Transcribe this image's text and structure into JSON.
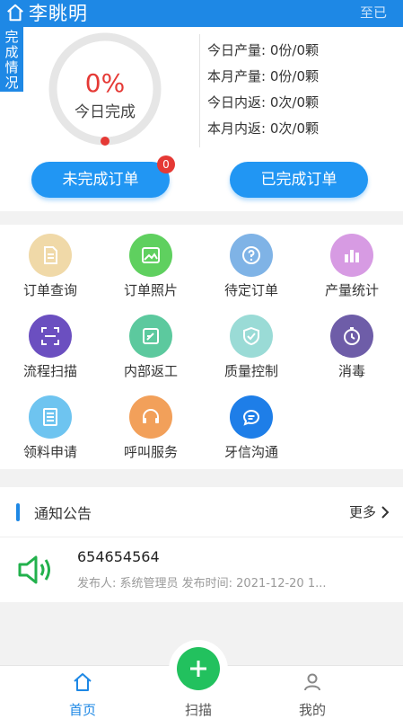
{
  "header": {
    "user_name": "李眺明",
    "right_text": "至已",
    "bg_color": "#1e88e5"
  },
  "summary": {
    "ribbon_text": "完成情况",
    "progress_percent_text": "0%",
    "progress_value": 0,
    "progress_label": "今日完成",
    "stats": [
      {
        "label": "今日产量:",
        "value": "0份/0颗"
      },
      {
        "label": "本月产量:",
        "value": "0份/0颗"
      },
      {
        "label": "今日内返:",
        "value": "0次/0颗"
      },
      {
        "label": "本月内返:",
        "value": "0次/0颗"
      }
    ],
    "pending_button": "未完成订单",
    "pending_badge": "0",
    "done_button": "已完成订单"
  },
  "grid": {
    "items": [
      {
        "label": "订单查询",
        "icon": "document-icon",
        "color": "#f0d9a8"
      },
      {
        "label": "订单照片",
        "icon": "image-icon",
        "color": "#5fd05f"
      },
      {
        "label": "待定订单",
        "icon": "question-icon",
        "color": "#7fb3e6"
      },
      {
        "label": "产量统计",
        "icon": "bar-chart-icon",
        "color": "#d79be3"
      },
      {
        "label": "流程扫描",
        "icon": "scan-icon",
        "color": "#6b4fc0"
      },
      {
        "label": "内部返工",
        "icon": "edit-icon",
        "color": "#5cc99e"
      },
      {
        "label": "质量控制",
        "icon": "shield-check-icon",
        "color": "#9adbd6"
      },
      {
        "label": "消毒",
        "icon": "stopwatch-icon",
        "color": "#6e5da8"
      },
      {
        "label": "领料申请",
        "icon": "form-icon",
        "color": "#6ec4f0"
      },
      {
        "label": "呼叫服务",
        "icon": "headset-icon",
        "color": "#f2a05a"
      },
      {
        "label": "牙信沟通",
        "icon": "chat-icon",
        "color": "#1e7ee8"
      }
    ]
  },
  "notice": {
    "section_title": "通知公告",
    "more_label": "更多",
    "item_title": "654654564",
    "item_meta": "发布人: 系统管理员   发布时间: 2021-12-20 1..."
  },
  "tabbar": {
    "home_label": "首页",
    "scan_label": "扫描",
    "mine_label": "我的",
    "active_color": "#1e88e5",
    "scan_color": "#22c15e"
  }
}
